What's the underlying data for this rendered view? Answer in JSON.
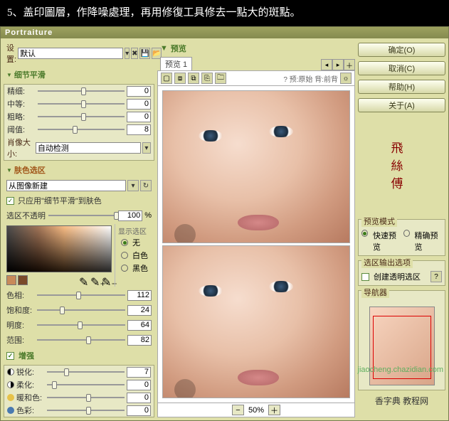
{
  "caption": "5、盖印圖層，作降噪處理，再用修復工具修去一點大的斑點。",
  "dialog_title": "Portraiture",
  "settings_label": "设置:",
  "preset_value": "默认",
  "sections": {
    "detail_smooth": "细节平滑",
    "skin_mask": "肤色选区",
    "enhance": "增强"
  },
  "detail_sliders": {
    "fine": {
      "label": "精细:",
      "value": 0,
      "pos": 50
    },
    "medium": {
      "label": "中等:",
      "value": 0,
      "pos": 50
    },
    "coarse": {
      "label": "粗略:",
      "value": 0,
      "pos": 50
    },
    "threshold": {
      "label": "阈值:",
      "value": 8,
      "pos": 40
    }
  },
  "portrait_size_label": "肖像大小:",
  "portrait_size_value": "自动检测",
  "skin_mask_src_value": "从图像新建",
  "only_apply_label": "只应用\"细节平滑\"到肤色",
  "only_apply_checked": true,
  "mask_opacity": {
    "label": "选区不透明",
    "value": 100,
    "unit": "%",
    "pos": 97
  },
  "mask_display_label": "显示选区",
  "mask_display_opts": {
    "none": "无",
    "white": "白色",
    "black": "黑色"
  },
  "mask_display_sel": "none",
  "color_sliders": {
    "hue": {
      "label": "色相:",
      "value": 112,
      "pos": 44
    },
    "sat": {
      "label": "饱和度:",
      "value": 24,
      "pos": 26
    },
    "lum": {
      "label": "明度:",
      "value": 64,
      "pos": 46
    },
    "range": {
      "label": "范围:",
      "value": 82,
      "pos": 56
    }
  },
  "enhance_checked": true,
  "enhance_sliders": {
    "sharpen": {
      "label": "锐化:",
      "value": 7,
      "pos": 22
    },
    "soften": {
      "label": "柔化:",
      "value": 0,
      "pos": 6
    },
    "warm": {
      "label": "暖和色:",
      "value": 0,
      "pos": 50
    },
    "tint": {
      "label": "色彩:",
      "value": 0,
      "pos": 50
    }
  },
  "preview_heading": "预览",
  "preview_tab": "预览 1",
  "preview_sub": "? 预:原始 背:前背",
  "zoom_value": "50%",
  "buttons": {
    "ok": "确定(O)",
    "cancel": "取消(C)",
    "help": "帮助(H)",
    "about": "关于(A)"
  },
  "groups": {
    "preview_mode": "预览模式",
    "mask_out": "选区输出选项",
    "navigator": "导航器"
  },
  "preview_mode": {
    "fast": "快速预览",
    "precise": "精确预览",
    "sel": "fast"
  },
  "create_alpha_label": "创建透明选区",
  "create_alpha_checked": false,
  "watermark": "jiaocheng.chazidian.com",
  "side_logo": "香字典 教程网"
}
